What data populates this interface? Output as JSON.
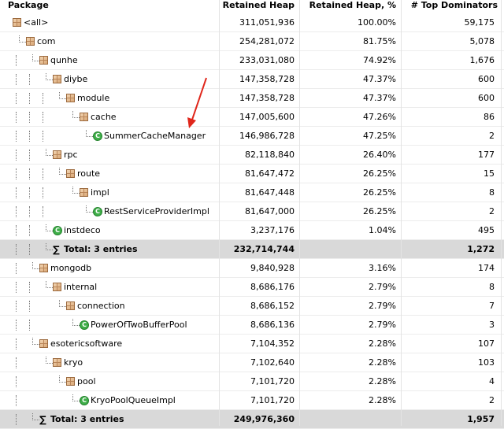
{
  "columns": {
    "package": "Package",
    "retained_heap": "Retained Heap",
    "retained_pct": "Retained Heap, %",
    "top_dominators": "# Top Dominators"
  },
  "rows": [
    {
      "label": "<all>",
      "heap": "311,051,936",
      "pct": "100.00%",
      "dom": "59,175",
      "depth": 0,
      "kind": "package",
      "guides": []
    },
    {
      "label": "com",
      "heap": "254,281,072",
      "pct": "81.75%",
      "dom": "5,078",
      "depth": 1,
      "kind": "package",
      "guides": []
    },
    {
      "label": "qunhe",
      "heap": "233,031,080",
      "pct": "74.92%",
      "dom": "1,676",
      "depth": 2,
      "kind": "package",
      "guides": [
        1
      ]
    },
    {
      "label": "diybe",
      "heap": "147,358,728",
      "pct": "47.37%",
      "dom": "600",
      "depth": 3,
      "kind": "package",
      "guides": [
        1,
        2
      ]
    },
    {
      "label": "module",
      "heap": "147,358,728",
      "pct": "47.37%",
      "dom": "600",
      "depth": 4,
      "kind": "package",
      "guides": [
        1,
        2,
        3
      ]
    },
    {
      "label": "cache",
      "heap": "147,005,600",
      "pct": "47.26%",
      "dom": "86",
      "depth": 5,
      "kind": "package",
      "guides": [
        1,
        2,
        3
      ]
    },
    {
      "label": "SummerCacheManager",
      "heap": "146,986,728",
      "pct": "47.25%",
      "dom": "2",
      "depth": 6,
      "kind": "class",
      "guides": [
        1,
        2,
        3
      ]
    },
    {
      "label": "rpc",
      "heap": "82,118,840",
      "pct": "26.40%",
      "dom": "177",
      "depth": 3,
      "kind": "package",
      "guides": [
        1,
        2
      ]
    },
    {
      "label": "route",
      "heap": "81,647,472",
      "pct": "26.25%",
      "dom": "15",
      "depth": 4,
      "kind": "package",
      "guides": [
        1,
        2,
        3
      ]
    },
    {
      "label": "impl",
      "heap": "81,647,448",
      "pct": "26.25%",
      "dom": "8",
      "depth": 5,
      "kind": "package",
      "guides": [
        1,
        2,
        3
      ]
    },
    {
      "label": "RestServiceProviderImpl",
      "heap": "81,647,000",
      "pct": "26.25%",
      "dom": "2",
      "depth": 6,
      "kind": "class",
      "guides": [
        1,
        2,
        3
      ]
    },
    {
      "label": "instdeco",
      "heap": "3,237,176",
      "pct": "1.04%",
      "dom": "495",
      "depth": 3,
      "kind": "class",
      "guides": [
        1,
        2
      ]
    },
    {
      "label": "Total: 3 entries",
      "heap": "232,714,744",
      "pct": "",
      "dom": "1,272",
      "depth": 3,
      "kind": "total",
      "guides": [
        1,
        2
      ]
    },
    {
      "label": "mongodb",
      "heap": "9,840,928",
      "pct": "3.16%",
      "dom": "174",
      "depth": 2,
      "kind": "package",
      "guides": [
        1
      ]
    },
    {
      "label": "internal",
      "heap": "8,686,176",
      "pct": "2.79%",
      "dom": "8",
      "depth": 3,
      "kind": "package",
      "guides": [
        1,
        2
      ]
    },
    {
      "label": "connection",
      "heap": "8,686,152",
      "pct": "2.79%",
      "dom": "7",
      "depth": 4,
      "kind": "package",
      "guides": [
        1,
        2
      ]
    },
    {
      "label": "PowerOfTwoBufferPool",
      "heap": "8,686,136",
      "pct": "2.79%",
      "dom": "3",
      "depth": 5,
      "kind": "class",
      "guides": [
        1,
        2
      ]
    },
    {
      "label": "esotericsoftware",
      "heap": "7,104,352",
      "pct": "2.28%",
      "dom": "107",
      "depth": 2,
      "kind": "package",
      "guides": [
        1
      ]
    },
    {
      "label": "kryo",
      "heap": "7,102,640",
      "pct": "2.28%",
      "dom": "103",
      "depth": 3,
      "kind": "package",
      "guides": [
        1
      ]
    },
    {
      "label": "pool",
      "heap": "7,101,720",
      "pct": "2.28%",
      "dom": "4",
      "depth": 4,
      "kind": "package",
      "guides": [
        1
      ]
    },
    {
      "label": "KryoPoolQueueImpl",
      "heap": "7,101,720",
      "pct": "2.28%",
      "dom": "2",
      "depth": 5,
      "kind": "class",
      "guides": [
        1
      ]
    },
    {
      "label": "Total: 3 entries",
      "heap": "249,976,360",
      "pct": "",
      "dom": "1,957",
      "depth": 2,
      "kind": "total",
      "guides": [
        1
      ]
    }
  ],
  "icons": {
    "package": "package-icon",
    "class": "class-icon",
    "total": "sigma-icon"
  },
  "colors": {
    "total_row_bg": "#d9d9d9",
    "class_icon": "#3fae49",
    "arrow": "#e0261b"
  }
}
